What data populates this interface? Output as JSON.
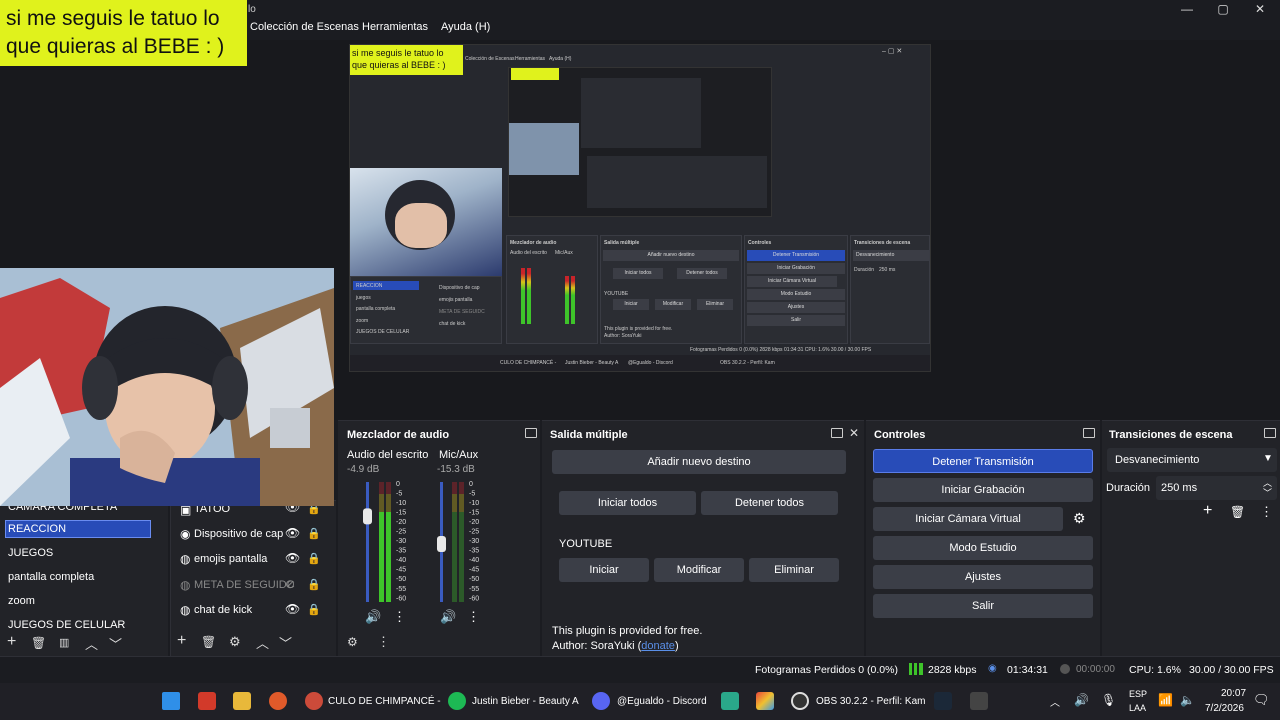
{
  "window": {
    "title_fragment": "lo",
    "minimize": "—",
    "maximize": "▢",
    "close": "✕"
  },
  "menu": [
    "Colección de Escenas",
    "Herramientas",
    "Ayuda (H)"
  ],
  "overlay_text": {
    "line1": "si me seguis le tatuo lo",
    "line2": "que quieras al BEBE : )"
  },
  "nested_preview": {
    "overlay_text": "si me seguis le tatuo lo que quieras al BEBE : )",
    "menu": [
      "Colección de Escenas",
      "Herramientas",
      "Ayuda (H)"
    ],
    "mixer_title": "Mezclador de audio",
    "multi_title": "Salida múltiple",
    "controls_title": "Controles",
    "transitions_title": "Transiciones de escena",
    "audio1": "Audio del escrito",
    "audio2": "Mic/Aux",
    "btn_add": "Añadir nuevo destino",
    "btn_start_all": "Iniciar todos",
    "btn_stop_all": "Detener todos",
    "youtube": "YOUTUBE",
    "btn_start": "Iniciar",
    "btn_modify": "Modificar",
    "btn_delete": "Eliminar",
    "plugin1": "This plugin is provided for free.",
    "plugin2": "Author: SoraYuki",
    "ctrl": [
      "Detener Transmisión",
      "Iniciar Grabación",
      "Iniciar Cámara Virtual",
      "Modo Estudio",
      "Ajustes",
      "Salir"
    ],
    "transition": "Desvanecimiento",
    "duration_label": "Duración",
    "duration": "250 ms",
    "scenes": [
      "REACCION",
      "juegos",
      "pantalla completa",
      "zoom",
      "JUEGOS DE CELULAR"
    ],
    "sources": [
      "Dispositivo de cap",
      "emojis pantalla",
      "META DE SEGUIDC",
      "chat de kick"
    ],
    "status": "Fotogramas Perdidos 0 (0.0%)   2828 kbps   01:34:31   CPU: 1.6%   30.00 / 30.00 FPS",
    "taskbar": [
      "CULO DE CHIMPANCÉ -",
      "Justin Bieber - Beauty A",
      "@Egualdo - Discord",
      "OBS 30.2.2 - Perfil: Kam"
    ]
  },
  "scenes": {
    "items": [
      "CAMARA COMPLETA",
      "REACCION",
      "JUEGOS",
      "pantalla completa",
      "zoom",
      "JUEGOS DE CELULAR"
    ],
    "selected": "REACCION"
  },
  "sources": {
    "items": [
      "TATOO",
      "Dispositivo de cap",
      "emojis pantalla",
      "META DE SEGUIDC",
      "chat de kick"
    ]
  },
  "mixer": {
    "title": "Mezclador de audio",
    "ch1": {
      "name": "Audio del escrito",
      "db": "-4.9 dB",
      "level": 0.76
    },
    "ch2": {
      "name": "Mic/Aux",
      "db": "-15.3 dB",
      "level": 0.62
    },
    "scale": [
      "0",
      "-5",
      "-10",
      "-15",
      "-20",
      "-25",
      "-30",
      "-35",
      "-40",
      "-45",
      "-50",
      "-55",
      "-60"
    ]
  },
  "multi": {
    "title": "Salida múltiple",
    "add": "Añadir nuevo destino",
    "start_all": "Iniciar todos",
    "stop_all": "Detener todos",
    "target": "YOUTUBE",
    "start": "Iniciar",
    "modify": "Modificar",
    "delete": "Eliminar",
    "plugin_line": "This plugin is provided for free.",
    "author_prefix": "Author: SoraYuki (",
    "donate": "donate",
    "author_suffix": ")"
  },
  "controls": {
    "title": "Controles",
    "stop_stream": "Detener Transmisión",
    "start_record": "Iniciar Grabación",
    "virtual_cam": "Iniciar Cámara Virtual",
    "studio": "Modo Estudio",
    "settings": "Ajustes",
    "exit": "Salir"
  },
  "transitions": {
    "title": "Transiciones de escena",
    "selected": "Desvanecimiento",
    "duration_label": "Duración",
    "duration": "250 ms"
  },
  "status": {
    "dropped": "Fotogramas Perdidos 0 (0.0%)",
    "bitrate": "2828 kbps",
    "live_time": "01:34:31",
    "rec_time": "00:00:00",
    "cpu": "CPU: 1.6%",
    "fps": "30.00 / 30.00 FPS"
  },
  "taskbar": {
    "apps": [
      "CULO DE CHIMPANCÉ -",
      "Justin Bieber - Beauty A",
      "@Egualdo - Discord",
      "OBS 30.2.2 - Perfil: Kam"
    ],
    "lang1": "ESP",
    "lang2": "LAA",
    "time": "20:07",
    "date": "7/2/2026"
  },
  "colors": {
    "accent": "#284cb8",
    "overlay": "#e0f21c",
    "meter_green": "#3ec42a",
    "meter_yellow": "#d6c21a",
    "meter_red": "#c8242a"
  }
}
